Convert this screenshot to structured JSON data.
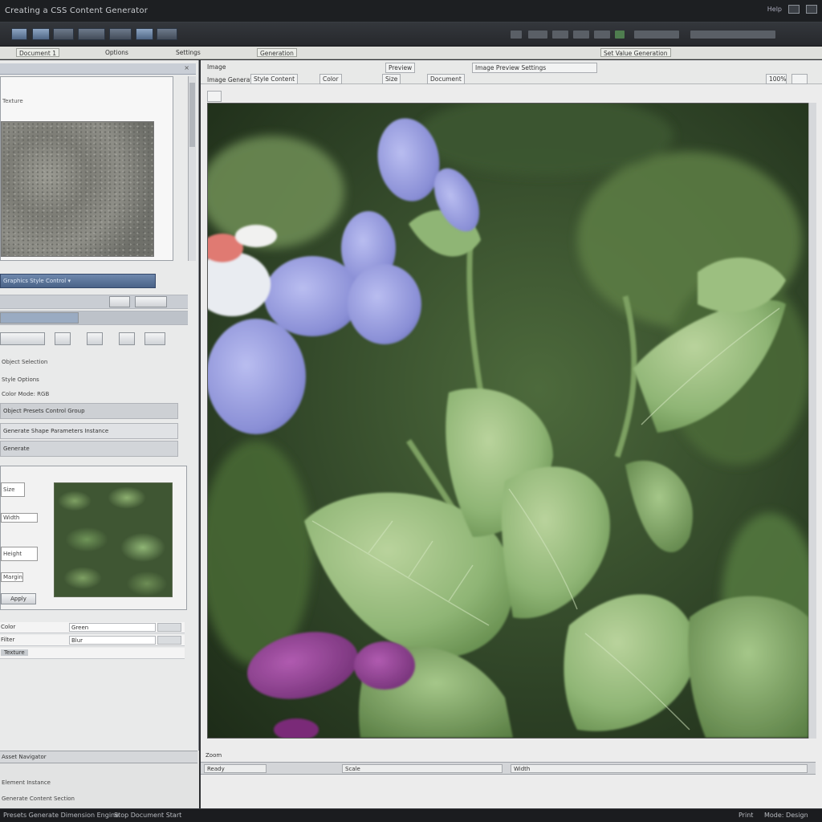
{
  "window": {
    "title": "Creating a CSS Content Generator",
    "right_label": "Help",
    "btn_restore": "",
    "btn_close": ""
  },
  "tabs": [
    {
      "label": "Document 1"
    },
    {
      "label": "Options"
    },
    {
      "label": "Settings"
    },
    {
      "label": "Generation"
    }
  ],
  "tabbar_right": "Set Value Generation",
  "left": {
    "preview_label": "Texture",
    "blue_bar": "Graphics Style Control  ▾",
    "row1": "Object Selection",
    "row2": "Style Options",
    "row3": "Color Mode: RGB",
    "sel1": "Object Presets Control Group",
    "sel2": "Generate Shape Parameters Instance",
    "sel3": "Generate",
    "fields": [
      "Size",
      "Width",
      "Height",
      "Margin",
      "Apply"
    ],
    "table": [
      {
        "label": "Color",
        "value": "Green"
      },
      {
        "label": "Filter",
        "value": "Blur"
      },
      {
        "label": "Texture",
        "value": ""
      }
    ],
    "bottom_bar": "Asset Navigator",
    "bottom_line1": "Element Instance",
    "bottom_line2": "Generate Content Section"
  },
  "main": {
    "head_label": "Image",
    "head_tabs": [
      "Image Generation",
      "Style Content",
      "Color",
      "Size",
      "Document"
    ],
    "head_top_tabs": [
      "Preview",
      "Image Preview Settings"
    ],
    "zoom": "100%",
    "status_top": "Zoom",
    "status_fields": [
      "Ready",
      "Scale",
      "Width"
    ]
  },
  "bottombar": {
    "left": "Presets Generate Dimension Engine",
    "mid": "Stop Document Start",
    "right1": "Print",
    "right2": "Mode: Design"
  },
  "colors": {
    "title_bg": "#1d1f22",
    "panel_blue": "#4a6388",
    "foliage": "#8fb575",
    "petal": "#8a8fd6",
    "petal_magenta": "#8b3a8d"
  }
}
